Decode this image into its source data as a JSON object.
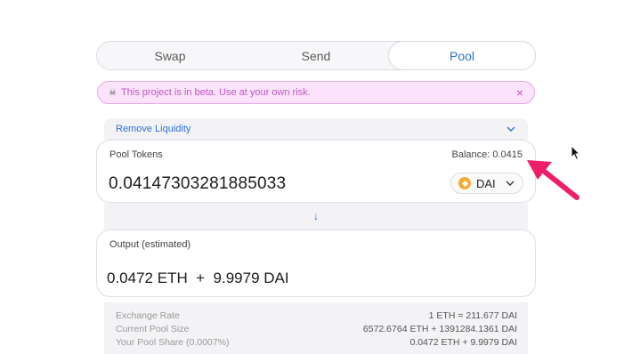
{
  "tabs": [
    {
      "label": "Swap",
      "active": false
    },
    {
      "label": "Send",
      "active": false
    },
    {
      "label": "Pool",
      "active": true
    }
  ],
  "beta_banner": {
    "icon": "skull-icon",
    "text": "This project is in beta. Use at your own risk."
  },
  "remove_liquidity": {
    "label": "Remove Liquidity"
  },
  "pool_tokens": {
    "label": "Pool Tokens",
    "balance": "Balance: 0.0415",
    "amount": "0.04147303281885033",
    "token": "DAI"
  },
  "output": {
    "label": "Output (estimated)",
    "amount": "0.0472 ETH  +  9.9979 DAI"
  },
  "stats": [
    {
      "label": "Exchange Rate",
      "value": "1 ETH = 211.677 DAI"
    },
    {
      "label": "Current Pool Size",
      "value": "6572.6764 ETH + 1391284.1361 DAI"
    },
    {
      "label": "Your Pool Share (0.0007%)",
      "value": "0.0472 ETH + 9.9979 DAI"
    }
  ],
  "colors": {
    "accent": "#2f6fe0",
    "beta_bg": "#fbe4fb",
    "beta_text": "#c454c6",
    "annotation_arrow": "#ee1f6a",
    "dai": "#f5ac37"
  }
}
